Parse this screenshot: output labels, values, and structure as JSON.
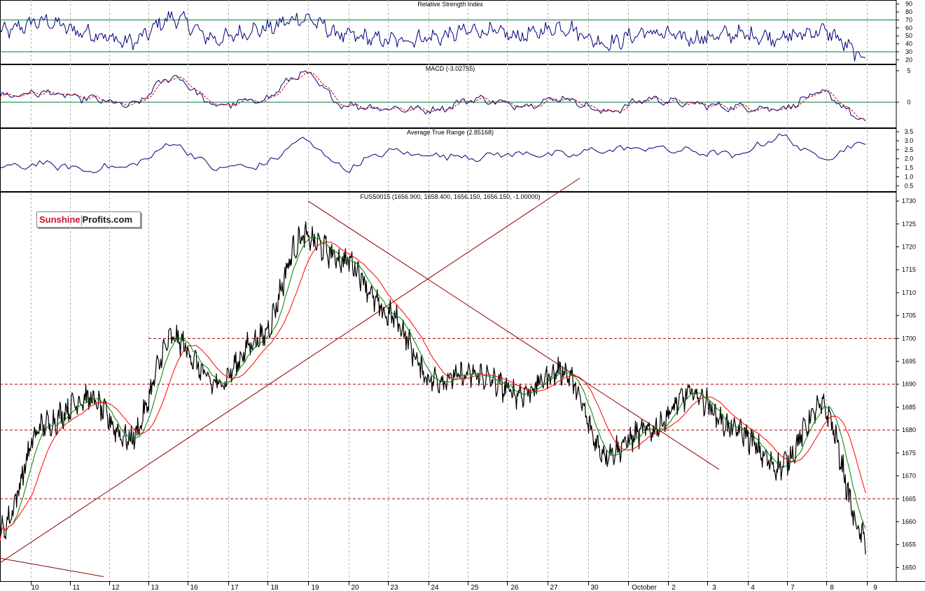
{
  "logo": {
    "part1": "Sunshine",
    "part2": "Profits.com"
  },
  "panels": {
    "rsi": {
      "title": "Relative Strength Index",
      "ticks": [
        "90",
        "80",
        "70",
        "60",
        "50",
        "40",
        "30",
        "20"
      ]
    },
    "macd": {
      "title": "MACD (-3.02755)",
      "ticks": [
        "5",
        "0"
      ]
    },
    "atr": {
      "title": "Average True Range (2.85168)",
      "ticks": [
        "3.5",
        "3.0",
        "2.5",
        "2.0",
        "1.5",
        "1.0",
        "0.5"
      ]
    },
    "price": {
      "title": "FUS50015 (1656.900, 1658.400, 1656.150, 1656.150, -1.00000)",
      "ticks": [
        "1730",
        "1725",
        "1720",
        "1715",
        "1710",
        "1705",
        "1700",
        "1695",
        "1690",
        "1685",
        "1680",
        "1675",
        "1670",
        "1665",
        "1660",
        "1655",
        "1650"
      ]
    }
  },
  "x_labels": [
    "10",
    "11",
    "12",
    "13",
    "16",
    "17",
    "18",
    "19",
    "20",
    "23",
    "24",
    "25",
    "26",
    "27",
    "30",
    "October",
    "2",
    "3",
    "4",
    "7",
    "8",
    "9"
  ],
  "colors": {
    "price": "#000000",
    "fast_ma": "#008000",
    "slow_ma": "#ff0000",
    "indicator": "#00007a",
    "signal": "#cc0000",
    "trendline": "#8b0000",
    "level": "#aa0000",
    "grid": "#b0b0b0"
  },
  "chart_data": [
    {
      "type": "line",
      "title": "Relative Strength Index",
      "ylim": [
        15,
        95
      ],
      "reference_levels": [
        30,
        70
      ],
      "categories": [
        "10",
        "11",
        "12",
        "13",
        "16",
        "17",
        "18",
        "19",
        "20",
        "23",
        "24",
        "25",
        "26",
        "27",
        "30",
        "October",
        "2",
        "3",
        "4",
        "7",
        "8"
      ],
      "series": [
        {
          "name": "",
          "values": [
            55,
            68,
            54,
            42,
            72,
            46,
            58,
            72,
            50,
            44,
            48,
            57,
            50,
            61,
            41,
            54,
            47,
            52,
            48,
            56,
            24
          ]
        }
      ]
    },
    {
      "type": "line",
      "title": "MACD (-3.02755)",
      "ylim": [
        -4,
        6
      ],
      "categories": [
        "10",
        "11",
        "12",
        "13",
        "16",
        "17",
        "18",
        "19",
        "20",
        "23",
        "24",
        "25",
        "26",
        "27",
        "30",
        "October",
        "2",
        "3",
        "4",
        "7",
        "8"
      ],
      "series": [
        {
          "name": "",
          "values": [
            1.0,
            1.5,
            0.6,
            -0.5,
            4.0,
            -0.5,
            0.3,
            4.5,
            -0.5,
            -1.0,
            -1.2,
            0.5,
            -0.5,
            0.6,
            -1.5,
            0.5,
            -0.3,
            -0.8,
            -1.0,
            1.4,
            -3.0
          ]
        }
      ]
    },
    {
      "type": "line",
      "title": "Average True Range (2.85168)",
      "ylim": [
        0.2,
        3.7
      ],
      "categories": [
        "10",
        "11",
        "12",
        "13",
        "16",
        "17",
        "18",
        "19",
        "20",
        "23",
        "24",
        "25",
        "26",
        "27",
        "30",
        "October",
        "2",
        "3",
        "4",
        "7",
        "8"
      ],
      "series": [
        {
          "name": "",
          "values": [
            1.5,
            1.7,
            1.4,
            1.6,
            2.8,
            1.5,
            1.6,
            3.0,
            1.5,
            2.4,
            2.2,
            2.1,
            2.3,
            2.2,
            2.5,
            2.6,
            2.4,
            2.2,
            3.2,
            2.1,
            2.85
          ]
        }
      ]
    },
    {
      "type": "line",
      "title": "FUS50015 (1656.900, 1658.400, 1656.150, 1656.150, -1.00000)",
      "ylim": [
        1647,
        1732
      ],
      "categories": [
        "10",
        "11",
        "12",
        "13",
        "16",
        "17",
        "18",
        "19",
        "20",
        "23",
        "24",
        "25",
        "26",
        "27",
        "30",
        "October",
        "2",
        "3",
        "4",
        "7",
        "8"
      ],
      "series": [
        {
          "name": "",
          "values": [
            1658,
            1681,
            1687,
            1678,
            1700,
            1690,
            1700,
            1722,
            1717,
            1705,
            1691,
            1692,
            1688,
            1693,
            1675,
            1680,
            1688,
            1680,
            1672,
            1685,
            1656
          ]
        }
      ],
      "reference_levels": [
        1700,
        1690,
        1680,
        1665
      ]
    }
  ]
}
